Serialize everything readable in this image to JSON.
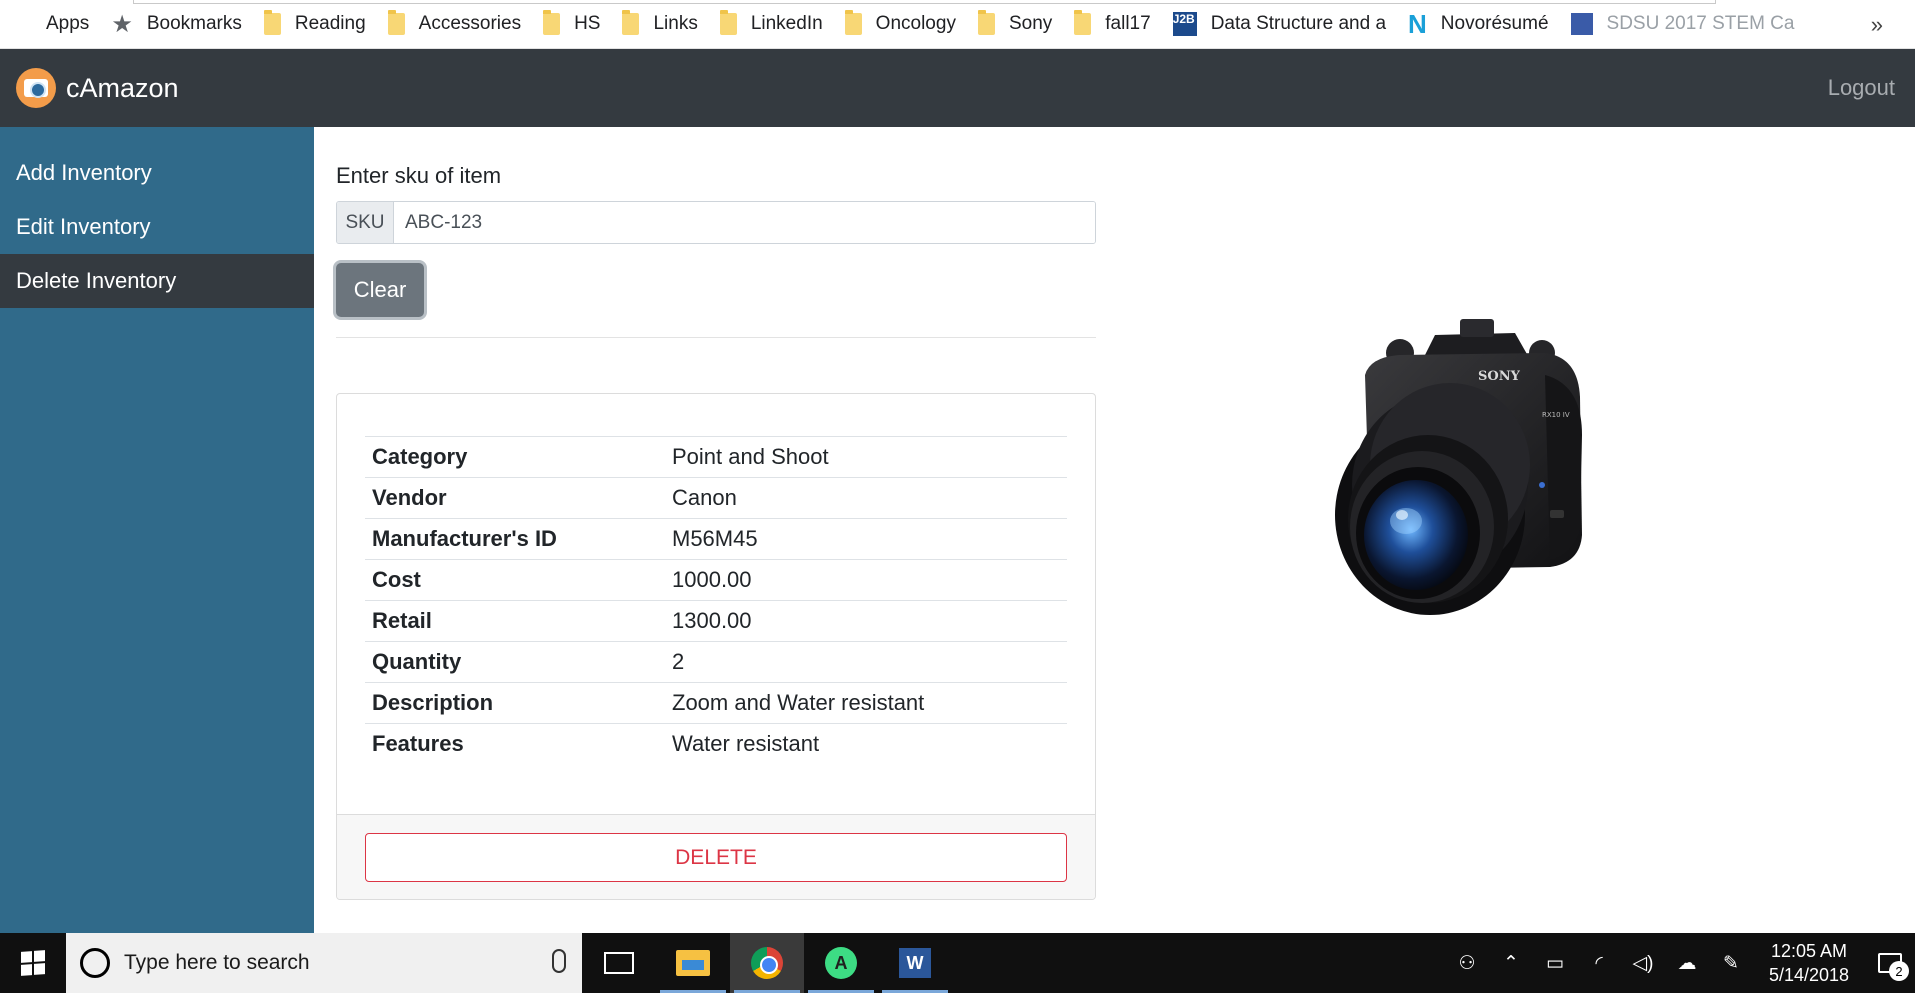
{
  "bookmarks_bar": {
    "items": [
      {
        "label": "Apps",
        "icon": "apps-grid-icon"
      },
      {
        "label": "Bookmarks",
        "icon": "star-icon"
      },
      {
        "label": "Reading",
        "icon": "folder-icon"
      },
      {
        "label": "Accessories",
        "icon": "folder-icon"
      },
      {
        "label": "HS",
        "icon": "folder-icon"
      },
      {
        "label": "Links",
        "icon": "folder-icon"
      },
      {
        "label": "LinkedIn",
        "icon": "folder-icon"
      },
      {
        "label": "Oncology",
        "icon": "folder-icon"
      },
      {
        "label": "Sony",
        "icon": "folder-icon"
      },
      {
        "label": "fall17",
        "icon": "folder-icon"
      },
      {
        "label": "Data Structure and a",
        "icon": "j2b-icon",
        "icon_text": "J2B"
      },
      {
        "label": "Novorésumé",
        "icon": "novoresume-icon",
        "icon_text": "N"
      },
      {
        "label": "SDSU 2017 STEM Ca",
        "icon": "sdsu-icon"
      }
    ],
    "overflow": "»"
  },
  "navbar": {
    "brand": "cAmazon",
    "logout": "Logout"
  },
  "sidebar": {
    "items": [
      {
        "label": "Add Inventory",
        "active": false
      },
      {
        "label": "Edit Inventory",
        "active": false
      },
      {
        "label": "Delete Inventory",
        "active": true
      }
    ]
  },
  "form": {
    "label": "Enter sku of item",
    "prefix": "SKU",
    "sku_value": "ABC-123",
    "clear_button": "Clear"
  },
  "details": {
    "rows": [
      {
        "key": "Category",
        "value": "Point and Shoot"
      },
      {
        "key": "Vendor",
        "value": "Canon"
      },
      {
        "key": "Manufacturer's ID",
        "value": "M56M45"
      },
      {
        "key": "Cost",
        "value": "1000.00"
      },
      {
        "key": "Retail",
        "value": "1300.00"
      },
      {
        "key": "Quantity",
        "value": "2"
      },
      {
        "key": "Description",
        "value": "Zoom and Water resistant"
      },
      {
        "key": "Features",
        "value": "Water resistant"
      }
    ],
    "delete_button": "DELETE"
  },
  "product_image": {
    "brand_text": "SONY",
    "model_text": "RX10 IV"
  },
  "taskbar": {
    "search_placeholder": "Type here to search",
    "apps": [
      "task-view-icon",
      "file-explorer-icon",
      "chrome-icon",
      "android-studio-icon",
      "word-icon"
    ],
    "active_app": "chrome-icon",
    "word_letter": "W",
    "android_letter": "A",
    "time": "12:05 AM",
    "date": "5/14/2018",
    "notification_count": "2"
  },
  "colors": {
    "navbar": "#343a40",
    "sidebar": "#306a8a",
    "sidebar_active": "#343a40",
    "danger": "#dc3545",
    "secondary": "#6c757d"
  }
}
